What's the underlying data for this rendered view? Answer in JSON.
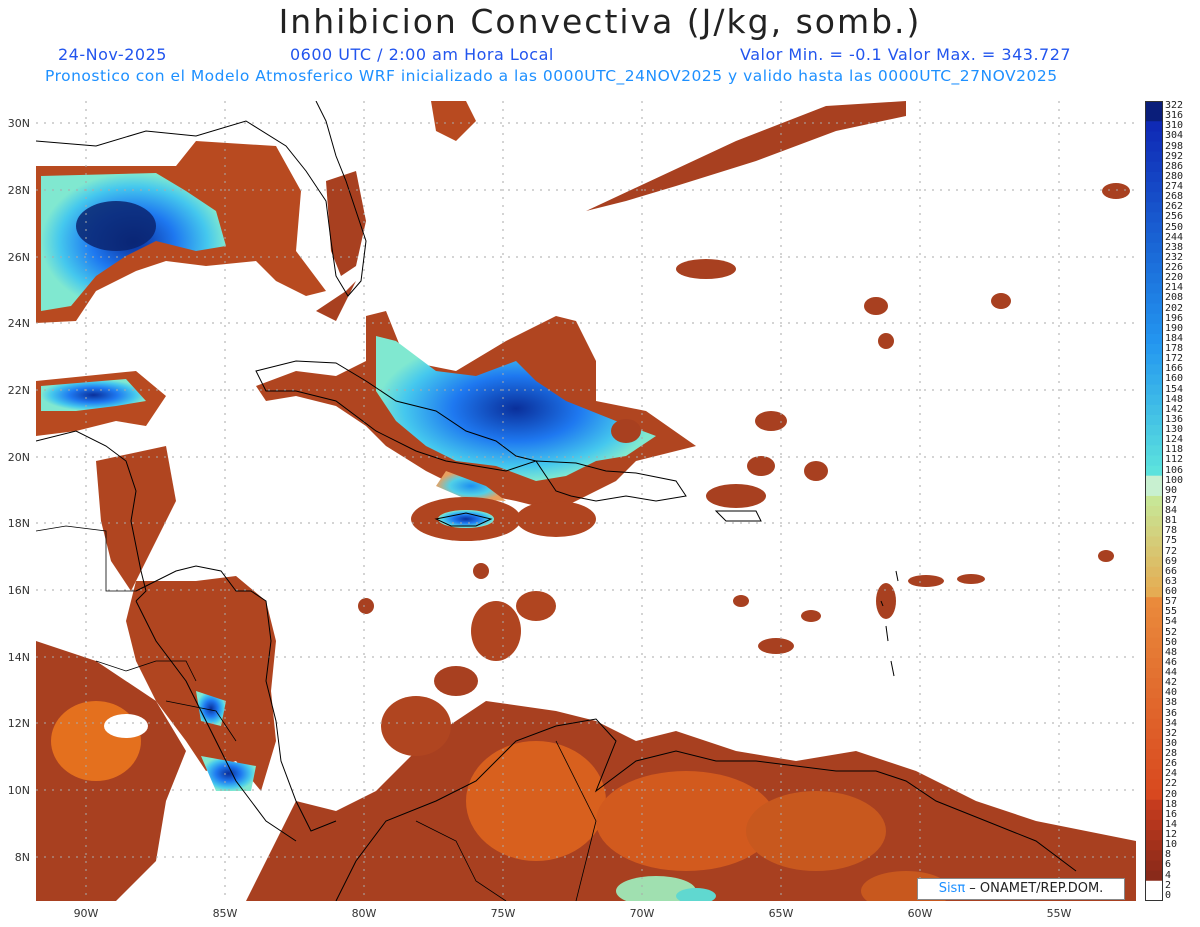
{
  "title": "Inhibicion Convectiva (J/kg, somb.)",
  "subtitle": {
    "date": "24-Nov-2025",
    "time": "0600 UTC / 2:00 am Hora Local",
    "minmax": "Valor Min. = -0.1  Valor Max. = 343.727",
    "model": "Pronostico con el Modelo Atmosferico WRF inicializado a las 0000UTC_24NOV2025 y valido hasta las  0000UTC_27NOV2025"
  },
  "axes": {
    "lat_labels": [
      "30N",
      "28N",
      "26N",
      "24N",
      "22N",
      "20N",
      "18N",
      "16N",
      "14N",
      "12N",
      "10N",
      "8N"
    ],
    "lon_labels": [
      "90W",
      "85W",
      "80W",
      "75W",
      "70W",
      "65W",
      "60W",
      "55W"
    ]
  },
  "colorbar": {
    "labels": [
      "322",
      "316",
      "310",
      "304",
      "298",
      "292",
      "286",
      "280",
      "274",
      "268",
      "262",
      "256",
      "250",
      "244",
      "238",
      "232",
      "226",
      "220",
      "214",
      "208",
      "202",
      "196",
      "190",
      "184",
      "178",
      "172",
      "166",
      "160",
      "154",
      "148",
      "142",
      "136",
      "130",
      "124",
      "118",
      "112",
      "106",
      "100",
      "90",
      "87",
      "84",
      "81",
      "78",
      "75",
      "72",
      "69",
      "66",
      "63",
      "60",
      "57",
      "55",
      "54",
      "52",
      "50",
      "48",
      "46",
      "44",
      "42",
      "40",
      "38",
      "36",
      "34",
      "32",
      "30",
      "28",
      "26",
      "24",
      "22",
      "20",
      "18",
      "16",
      "14",
      "12",
      "10",
      "8",
      "6",
      "4",
      "2",
      "0"
    ]
  },
  "credit": {
    "sis": "Sisπ",
    "text": " – ONAMET/REP.DOM."
  },
  "colors": {
    "low": "#8b2a1a",
    "mid": "#e8601a",
    "green": "#c8e8a0",
    "cyan": "#40e0d0",
    "blue": "#1e6ff0",
    "darkblue": "#0a1e7a"
  }
}
